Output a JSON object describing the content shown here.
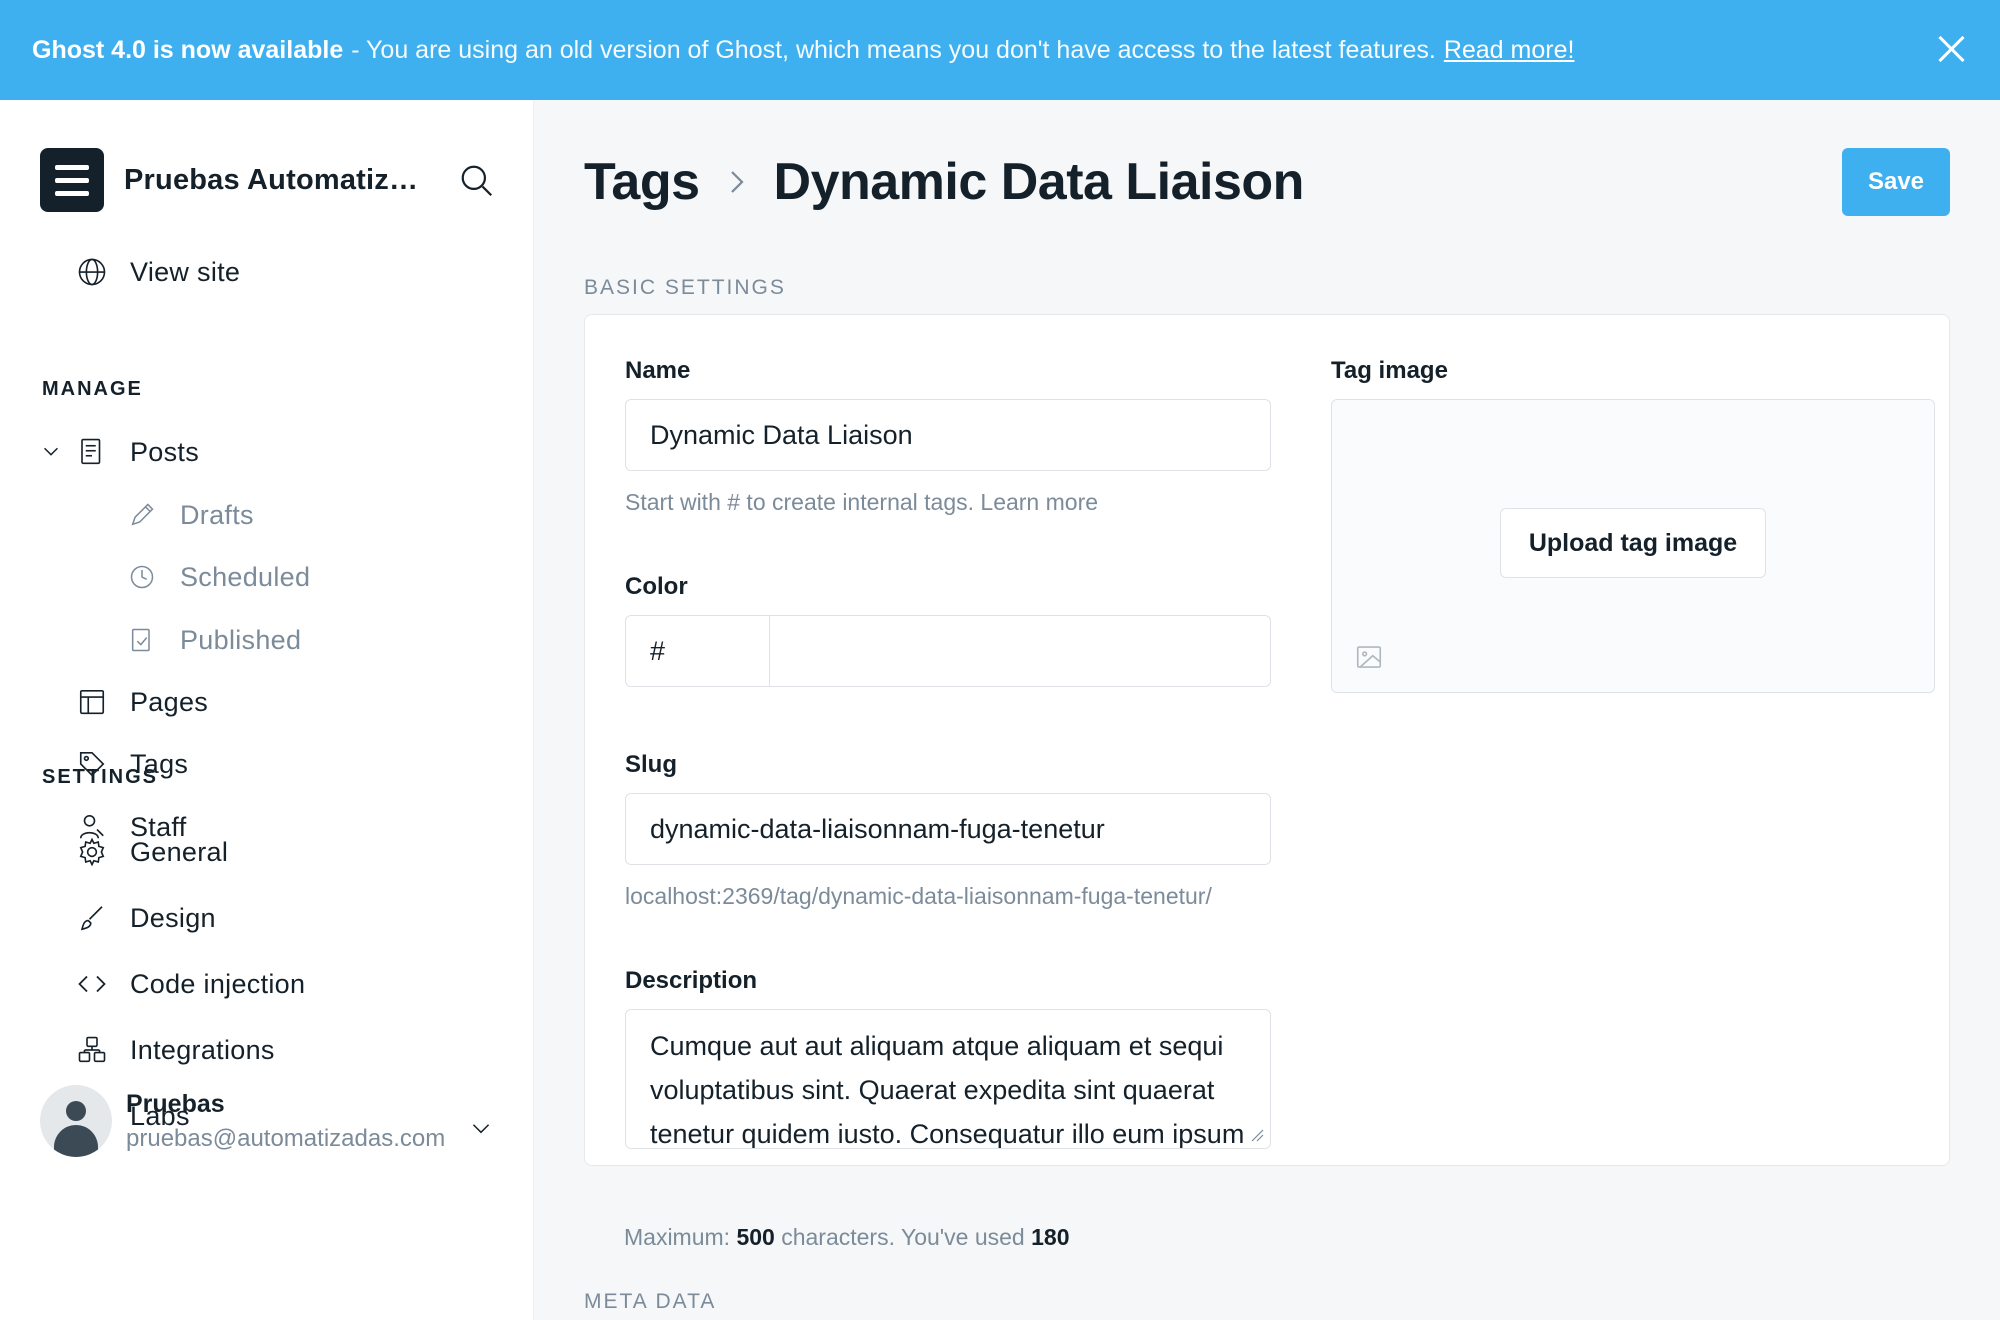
{
  "banner": {
    "headline": "Ghost 4.0 is now available",
    "message": "- You are using an old version of Ghost, which means you don't have access to the latest features.",
    "link": "Read more!"
  },
  "sidebar": {
    "site_name": "Pruebas Automatizadas",
    "sections": {
      "manage": "MANAGE",
      "settings": "SETTINGS"
    },
    "view_site": "View site",
    "posts": "Posts",
    "drafts": "Drafts",
    "scheduled": "Scheduled",
    "published": "Published",
    "pages": "Pages",
    "tags": "Tags",
    "staff": "Staff",
    "general": "General",
    "design": "Design",
    "code_injection": "Code injection",
    "integrations": "Integrations",
    "labs": "Labs",
    "user": {
      "name": "Pruebas",
      "email": "pruebas@automatizadas.com"
    }
  },
  "header": {
    "breadcrumb_root": "Tags",
    "breadcrumb_current": "Dynamic Data Liaison",
    "save_label": "Save"
  },
  "basic_settings": {
    "section_label": "BASIC SETTINGS",
    "name_label": "Name",
    "name_value": "Dynamic Data Liaison",
    "name_hint": "Start with # to create internal tags. Learn more",
    "color_label": "Color",
    "color_hash": "#",
    "slug_label": "Slug",
    "slug_value": "dynamic-data-liaisonnam-fuga-tenetur",
    "slug_hint": "localhost:2369/tag/dynamic-data-liaisonnam-fuga-tenetur/",
    "description_label": "Description",
    "description_value": "Cumque aut aut aliquam atque aliquam et sequi voluptatibus sint. Quaerat expedita sint quaerat tenetur quidem iusto. Consequatur illo eum ipsum aut architecto",
    "description_hint_prefix": "Maximum:",
    "description_max": "500",
    "description_hint_mid": "characters. You've used",
    "description_used": "180",
    "tag_image_label": "Tag image",
    "upload_label": "Upload tag image"
  },
  "meta_data": {
    "section_label": "META DATA"
  },
  "colors": {
    "accent": "#3eb0ef",
    "text": "#15212a",
    "muted": "#7c8b9a",
    "background": "#f5f7f9"
  }
}
